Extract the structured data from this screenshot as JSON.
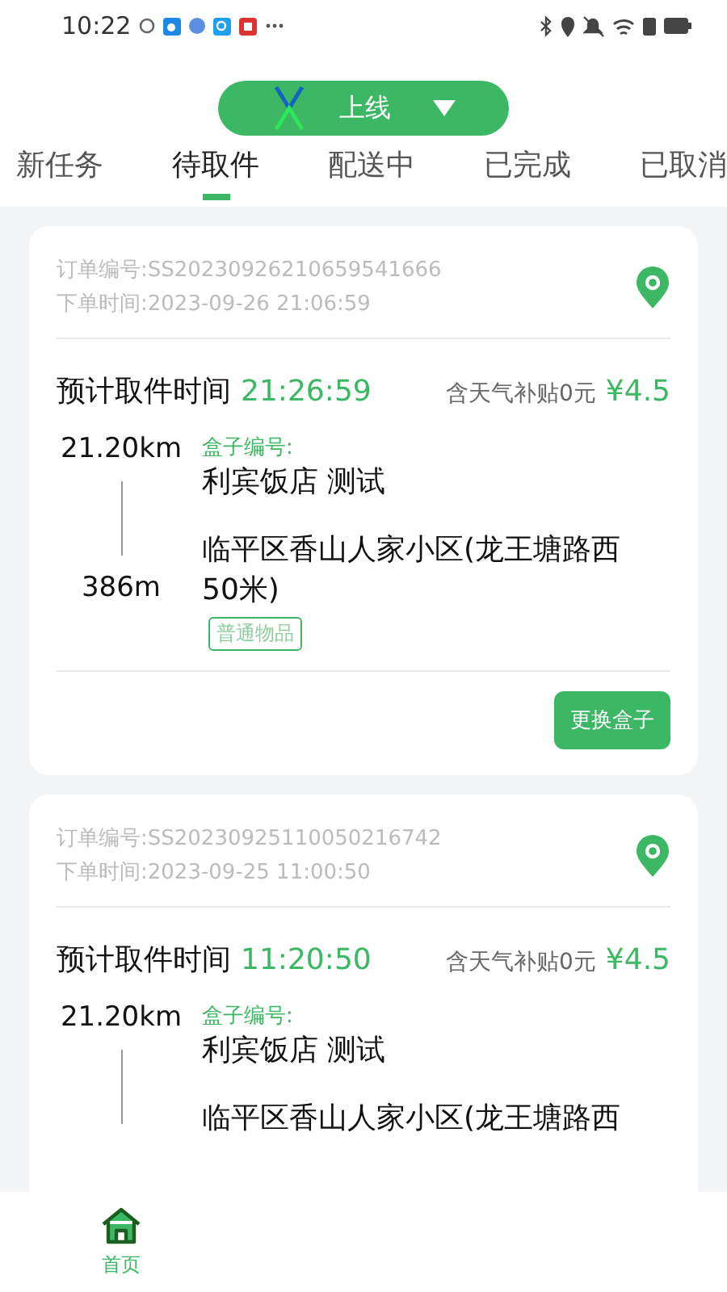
{
  "status_bar": {
    "time": "10:22"
  },
  "online_toggle": {
    "label": "上线"
  },
  "tabs": [
    {
      "label": "新任务",
      "selected": false
    },
    {
      "label": "待取件",
      "selected": true
    },
    {
      "label": "配送中",
      "selected": false
    },
    {
      "label": "已完成",
      "selected": false
    },
    {
      "label": "已取消",
      "selected": false
    }
  ],
  "orders": [
    {
      "order_no": "订单编号:SS20230926210659541666",
      "order_time": "下单时间:2023-09-26 21:06:59",
      "pickup_label": "预计取件时间",
      "pickup_time": "21:26:59",
      "subsidy": "含天气补贴0元",
      "price": "¥4.5",
      "distance_to_shop": "21.20km",
      "distance_to_customer": "386m",
      "box_label": "盒子编号:",
      "shop": "利宾饭店 测试",
      "address": "临平区香山人家小区(龙王塘路西50米)",
      "tag": "普通物品",
      "action": "更换盒子"
    },
    {
      "order_no": "订单编号:SS20230925110050216742",
      "order_time": "下单时间:2023-09-25 11:00:50",
      "pickup_label": "预计取件时间",
      "pickup_time": "11:20:50",
      "subsidy": "含天气补贴0元",
      "price": "¥4.5",
      "distance_to_shop": "21.20km",
      "box_label": "盒子编号:",
      "shop": "利宾饭店 测试",
      "address": "临平区香山人家小区(龙王塘路西"
    }
  ],
  "bottom_nav": [
    {
      "label": "首页",
      "selected": true
    }
  ]
}
